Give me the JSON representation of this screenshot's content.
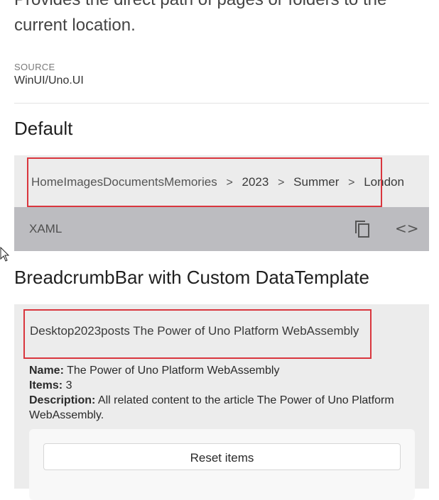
{
  "intro": {
    "text": "Provides the direct path of pages or folders to the current location."
  },
  "source": {
    "label": "SOURCE",
    "value": "WinUI/Uno.UI"
  },
  "sections": {
    "default_title": "Default",
    "custom_title": "BreadcrumbBar with Custom DataTemplate"
  },
  "default_breadcrumb": {
    "overlap_text": "HomeImagesDocumentsMemories",
    "items": [
      "Home",
      "Images",
      "Documents",
      "Memories",
      "2023",
      "Summer",
      "London"
    ],
    "visible": [
      "2023",
      "Summer",
      "London"
    ],
    "separator": ">"
  },
  "toolbar": {
    "xaml_label": "XAML",
    "copy_icon": "copy-icon",
    "code_icon": "code-icon",
    "code_glyph": "<>"
  },
  "custom_breadcrumb": {
    "overlap_text": "Desktop2023posts The Power of Uno Platform",
    "last": "WebAssembly"
  },
  "details": {
    "name_label": "Name:",
    "name_value": "The Power of Uno Platform WebAssembly",
    "items_label": "Items:",
    "items_value": "3",
    "description_label": "Description:",
    "description_value": "All related content to the article The Power of Uno Platform WebAssembly."
  },
  "actions": {
    "reset_label": "Reset items"
  },
  "colors": {
    "highlight": "#d9363e",
    "toolbar": "#bcbcc0",
    "card": "#ececec"
  }
}
